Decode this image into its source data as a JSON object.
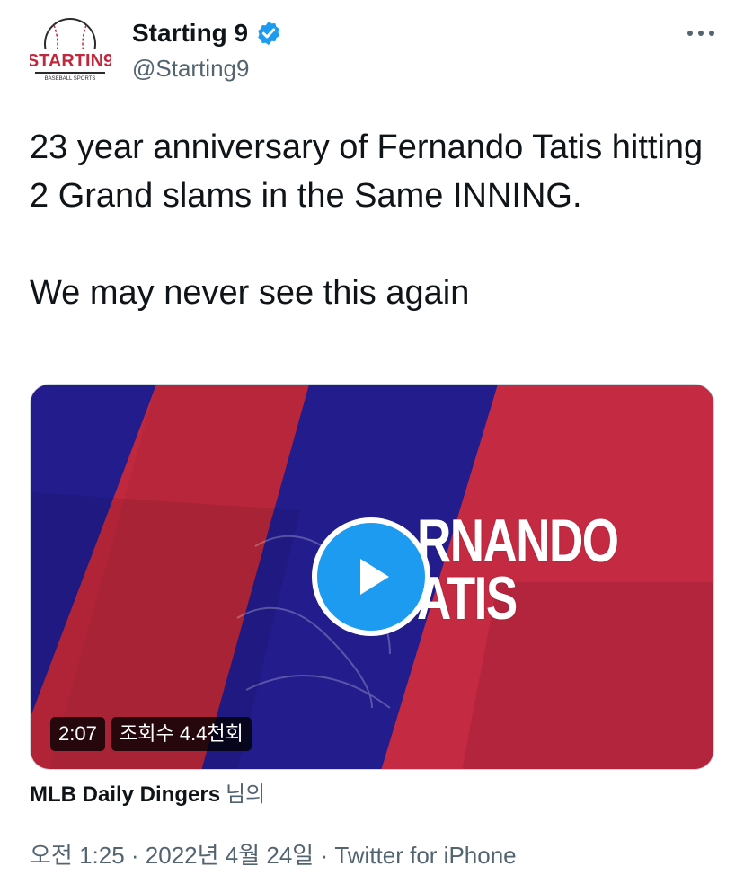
{
  "account": {
    "display_name": "Starting 9",
    "handle": "@Starting9",
    "logo_text": "STARTIN9",
    "logo_subtext": "BASEBALL SPORTS"
  },
  "tweet": {
    "paragraph_1": "23 year anniversary of Fernando Tatis hitting 2 Grand slams in the Same INNING.",
    "paragraph_2": "We may never see this again"
  },
  "media": {
    "title_line_1": "RNANDO",
    "title_line_2": "ATIS",
    "duration": "2:07",
    "views": "조회수 4.4천회",
    "colors": {
      "red": "#c0283d",
      "blue": "#221c8c",
      "accent": "#1d9bf0"
    }
  },
  "attribution": {
    "author": "MLB Daily Dingers",
    "suffix": "님의"
  },
  "meta": {
    "time": "오전 1:25",
    "separator_1": " · ",
    "date": "2022년 4월 24일",
    "separator_2": " · ",
    "source": "Twitter for iPhone"
  },
  "icons": {
    "verified": "verified-badge-icon",
    "more": "more-options-icon",
    "play": "play-icon"
  }
}
